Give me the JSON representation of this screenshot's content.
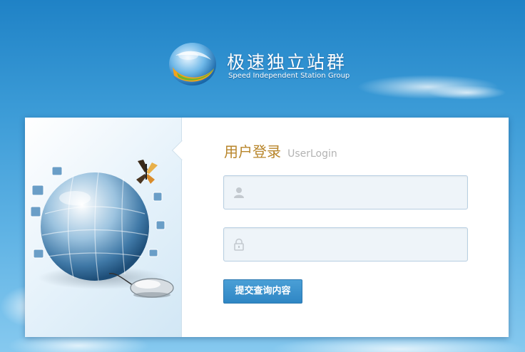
{
  "brand": {
    "title": "极速独立站群",
    "subtitle": "Speed Independent Station Group",
    "logo_icon": "globe-logo-icon"
  },
  "login": {
    "title_cn": "用户登录",
    "title_en": "UserLogin",
    "username_placeholder": "",
    "password_placeholder": "",
    "username_icon": "user-icon",
    "password_icon": "lock-icon",
    "submit_label": "提交查询内容"
  },
  "colors": {
    "background_top": "#1f82c6",
    "background_bottom": "#86c9ef",
    "title_accent": "#b8852a",
    "button": "#3a8fcb",
    "field_bg": "#eef4f9",
    "field_border": "#b8cfe2"
  }
}
